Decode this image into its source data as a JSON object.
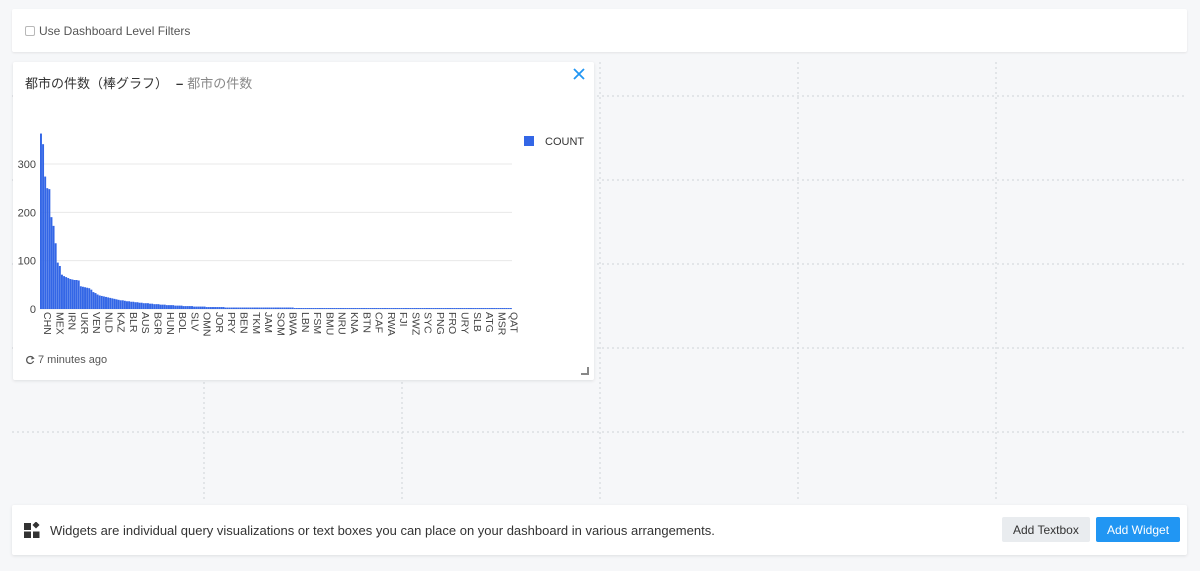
{
  "filters": {
    "label": "Use Dashboard Level Filters"
  },
  "widget": {
    "title": "都市の件数（棒グラフ）",
    "separator": "–",
    "subtitle": "都市の件数",
    "refresh_text": "7 minutes ago"
  },
  "footer": {
    "text": "Widgets are individual query visualizations or text boxes you can place on your dashboard in various arrangements.",
    "add_textbox_label": "Add Textbox",
    "add_widget_label": "Add Widget"
  },
  "colors": {
    "bar": "#3366e6",
    "primary_button": "#2196f3"
  },
  "chart_data": {
    "type": "bar",
    "series": [
      {
        "name": "COUNT"
      }
    ],
    "y_ticks": [
      0,
      100,
      200,
      300
    ],
    "ylim": [
      0,
      360
    ],
    "legend_position": "top-right",
    "grid": true,
    "x_tick_labels": [
      "CHN",
      "MEX",
      "IRN",
      "UKR",
      "VEN",
      "NLD",
      "KAZ",
      "BLR",
      "AUS",
      "BGR",
      "HUN",
      "BOL",
      "SLV",
      "OMN",
      "JOR",
      "PRY",
      "BEN",
      "TKM",
      "JAM",
      "SOM",
      "BWA",
      "LBN",
      "FSM",
      "BMU",
      "NRU",
      "KNA",
      "BTN",
      "CAF",
      "RWA",
      "FJI",
      "SWZ",
      "SYC",
      "PNG",
      "FRO",
      "URY",
      "SLB",
      "ATG",
      "MSR",
      "QAT"
    ],
    "values": [
      363,
      341,
      274,
      250,
      248,
      190,
      172,
      136,
      96,
      89,
      71,
      68,
      66,
      64,
      62,
      61,
      60,
      60,
      59,
      47,
      46,
      45,
      44,
      43,
      40,
      35,
      33,
      30,
      28,
      27,
      26,
      25,
      24,
      23,
      22,
      21,
      20,
      19,
      18,
      18,
      17,
      16,
      16,
      15,
      15,
      14,
      14,
      13,
      13,
      12,
      12,
      12,
      11,
      11,
      10,
      10,
      10,
      9,
      9,
      9,
      8,
      8,
      8,
      8,
      7,
      7,
      7,
      7,
      6,
      6,
      6,
      6,
      6,
      5,
      5,
      5,
      5,
      5,
      5,
      4,
      4,
      4,
      4,
      4,
      4,
      4,
      4,
      4,
      3,
      3,
      3,
      3,
      3,
      3,
      3,
      3,
      3,
      3,
      3,
      3,
      3,
      3,
      3,
      3,
      3,
      3,
      3,
      3,
      3,
      3,
      3,
      3,
      3,
      3,
      3,
      3,
      3,
      3,
      3,
      3,
      3,
      2,
      2,
      2,
      2,
      2,
      2,
      2,
      2,
      2,
      2,
      2,
      2,
      2,
      2,
      2,
      2,
      2,
      2,
      2,
      2,
      2,
      2,
      2,
      2,
      2,
      2,
      2,
      2,
      2,
      2,
      2,
      2,
      2,
      2,
      2,
      2,
      2,
      2,
      2,
      2,
      2,
      2,
      2,
      2,
      2,
      2,
      2,
      2,
      2,
      2,
      2,
      2,
      2,
      2,
      2,
      2,
      2,
      2,
      2,
      2,
      2,
      2,
      2,
      2,
      2,
      2,
      2,
      2,
      2,
      2,
      2,
      2,
      2,
      2,
      2,
      2,
      2,
      2,
      2,
      2,
      2,
      2,
      2,
      2,
      2,
      2,
      2,
      2,
      2,
      2,
      2,
      2,
      2,
      2,
      2,
      2,
      2,
      2,
      2,
      2,
      2,
      2,
      2,
      2
    ]
  }
}
